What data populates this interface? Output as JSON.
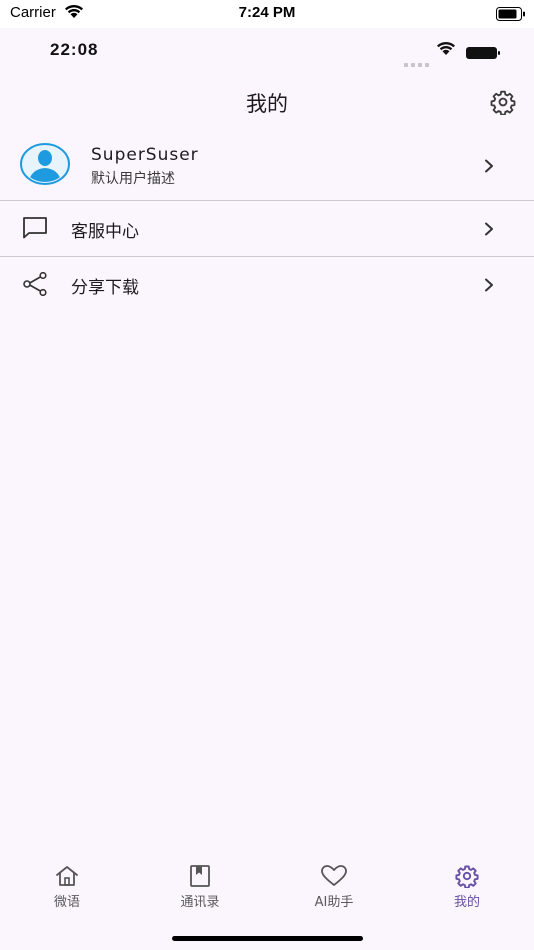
{
  "simulator_bar": {
    "carrier": "Carrier",
    "time": "7:24 PM"
  },
  "app_status": {
    "time": "22:08"
  },
  "header": {
    "title": "我的",
    "settings_icon": "gear-icon"
  },
  "profile": {
    "name": "SuperSuser",
    "description": "默认用户描述",
    "avatar_color": "#1E9BE0"
  },
  "menu": [
    {
      "label": "客服中心",
      "icon": "chat-bubble-icon"
    },
    {
      "label": "分享下载",
      "icon": "share-icon"
    }
  ],
  "bottom_nav": [
    {
      "label": "微语",
      "icon": "home-icon",
      "active": false
    },
    {
      "label": "通讯录",
      "icon": "bookmark-book-icon",
      "active": false
    },
    {
      "label": "AI助手",
      "icon": "heart-icon",
      "active": false
    },
    {
      "label": "我的",
      "icon": "gear-icon",
      "active": true
    }
  ],
  "colors": {
    "background": "#FBF5FD",
    "accent": "#6750A4",
    "divider": "#CFC7D2"
  }
}
